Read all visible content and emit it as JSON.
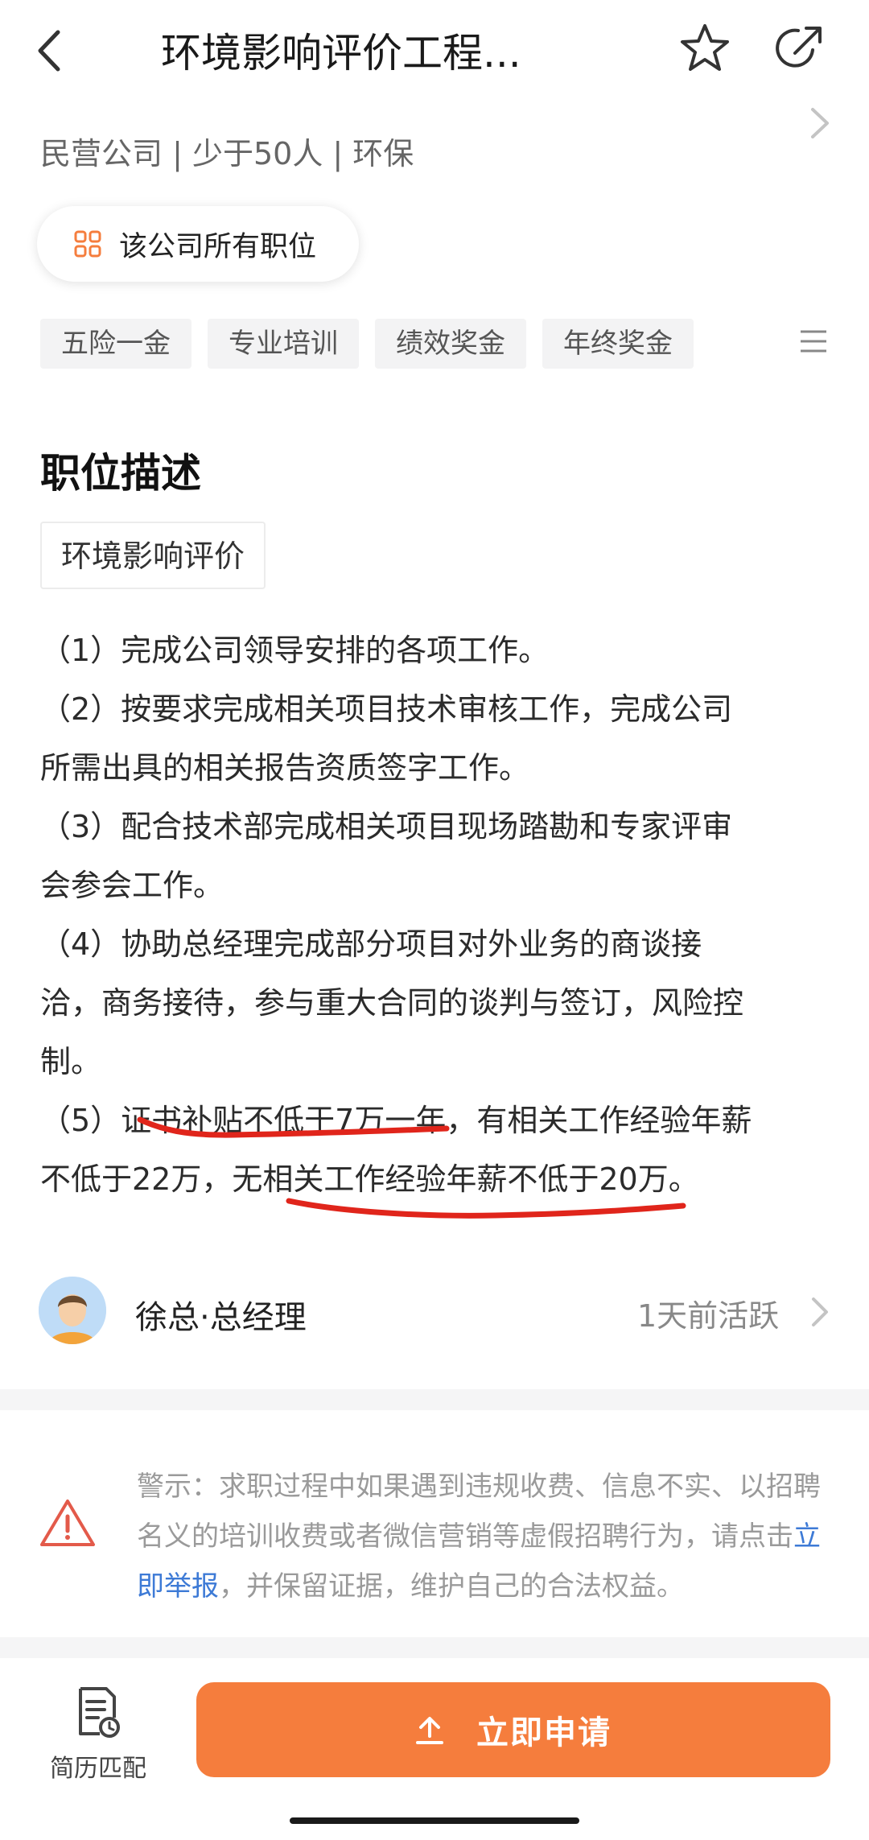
{
  "header": {
    "title": "环境影响评价工程...",
    "icons": {
      "back": "back-arrow-icon",
      "favorite": "star-icon",
      "share": "share-icon"
    }
  },
  "company": {
    "info": "民营公司 | 少于50人 | 环保",
    "all_jobs_label": "该公司所有职位"
  },
  "tags": [
    "五险一金",
    "专业培训",
    "绩效奖金",
    "年终奖金"
  ],
  "description": {
    "section_title": "职位描述",
    "category": "环境影响评价",
    "lines": [
      "（1）完成公司领导安排的各项工作。",
      "（2）按要求完成相关项目技术审核工作，完成公司",
      "所需出具的相关报告资质签字工作。",
      "（3）配合技术部完成相关项目现场踏勘和专家评审",
      "会参会工作。",
      "（4）协助总经理完成部分项目对外业务的商谈接",
      "洽，商务接待，参与重大合同的谈判与签订，风险控",
      "制。",
      "（5）证书补贴不低于7万一年，有相关工作经验年薪",
      "不低于22万，无相关工作经验年薪不低于20万。"
    ]
  },
  "recruiter": {
    "name": "徐总·总经理",
    "active": "1天前活跃"
  },
  "warning": {
    "text_before": "警示：求职过程中如果遇到违规收费、信息不实、以招聘名义的培训收费或者微信营销等虚假招聘行为，请点击",
    "link": "立即举报",
    "text_after": "，并保留证据，维护自己的合法权益。"
  },
  "bottom": {
    "resume_label": "简历匹配",
    "apply_label": "立即申请"
  },
  "colors": {
    "accent": "#f57d3d",
    "link": "#3d7ad6",
    "annotation": "#e0251b",
    "warning": "#e35a4a"
  }
}
